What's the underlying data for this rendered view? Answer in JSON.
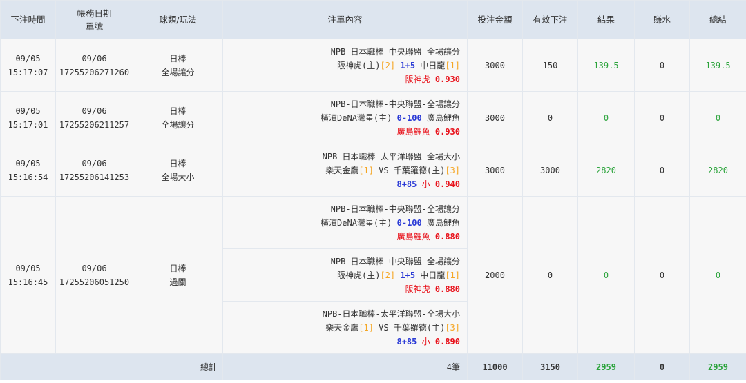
{
  "headers": {
    "bet_time": "下注時間",
    "acct_date": "帳務日期",
    "order_no": "單號",
    "sport_play": "球類/玩法",
    "content": "注單內容",
    "stake": "投注金額",
    "valid": "有效下注",
    "result": "結果",
    "rebate": "賺水",
    "total": "總結"
  },
  "rows": [
    {
      "date": "09/05",
      "time": "15:17:07",
      "acct_date": "09/06",
      "order_no": "17255206271260",
      "sport": "日棒",
      "play": "全場讓分",
      "details": [
        {
          "league": "NPB-日本職棒-中央聯盟-全場讓分",
          "home": "阪神虎(主)",
          "home_score": "[2]",
          "handicap": "1+5",
          "away": "中日龍",
          "away_score": "[1]",
          "pick": "阪神虎",
          "odds": "0.930"
        }
      ],
      "stake": "3000",
      "valid": "150",
      "result": "139.5",
      "rebate": "0",
      "total": "139.5"
    },
    {
      "date": "09/05",
      "time": "15:17:01",
      "acct_date": "09/06",
      "order_no": "17255206211257",
      "sport": "日棒",
      "play": "全場讓分",
      "details": [
        {
          "league": "NPB-日本職棒-中央聯盟-全場讓分",
          "home": "橫濱DeNA灣星(主)",
          "home_score": "",
          "handicap": "0-100",
          "away": "廣島鯉魚",
          "away_score": "",
          "pick": "廣島鯉魚",
          "odds": "0.930"
        }
      ],
      "stake": "3000",
      "valid": "0",
      "result": "0",
      "rebate": "0",
      "total": "0"
    },
    {
      "date": "09/05",
      "time": "15:16:54",
      "acct_date": "09/06",
      "order_no": "17255206141253",
      "sport": "日棒",
      "play": "全場大小",
      "details": [
        {
          "league": "NPB-日本職棒-太平洋聯盟-全場大小",
          "home": "樂天金鷹",
          "home_score": "[1]",
          "vs": "VS",
          "away": "千葉羅德(主)",
          "away_score": "[3]",
          "line": "8+85",
          "pick": "小",
          "odds": "0.940"
        }
      ],
      "stake": "3000",
      "valid": "3000",
      "result": "2820",
      "rebate": "0",
      "total": "2820"
    },
    {
      "date": "09/05",
      "time": "15:16:45",
      "acct_date": "09/06",
      "order_no": "17255206051250",
      "sport": "日棒",
      "play": "過關",
      "details": [
        {
          "league": "NPB-日本職棒-中央聯盟-全場讓分",
          "home": "橫濱DeNA灣星(主)",
          "home_score": "",
          "handicap": "0-100",
          "away": "廣島鯉魚",
          "away_score": "",
          "pick": "廣島鯉魚",
          "odds": "0.880"
        },
        {
          "league": "NPB-日本職棒-中央聯盟-全場讓分",
          "home": "阪神虎(主)",
          "home_score": "[2]",
          "handicap": "1+5",
          "away": "中日龍",
          "away_score": "[1]",
          "pick": "阪神虎",
          "odds": "0.880"
        },
        {
          "league": "NPB-日本職棒-太平洋聯盟-全場大小",
          "home": "樂天金鷹",
          "home_score": "[1]",
          "vs": "VS",
          "away": "千葉羅德(主)",
          "away_score": "[3]",
          "line": "8+85",
          "pick": "小",
          "odds": "0.890"
        }
      ],
      "stake": "2000",
      "valid": "0",
      "result": "0",
      "rebate": "0",
      "total": "0"
    }
  ],
  "footer": {
    "label": "總計",
    "count": "4筆",
    "stake": "11000",
    "valid": "3150",
    "result": "2959",
    "rebate": "0",
    "total": "2959"
  },
  "colors": {
    "header_bg": "#dde5ef",
    "row_bg": "#f7f7f7",
    "score": "#f5a623",
    "handicap": "#2b3bd6",
    "pick": "#e8121b",
    "positive": "#2aa33a"
  }
}
